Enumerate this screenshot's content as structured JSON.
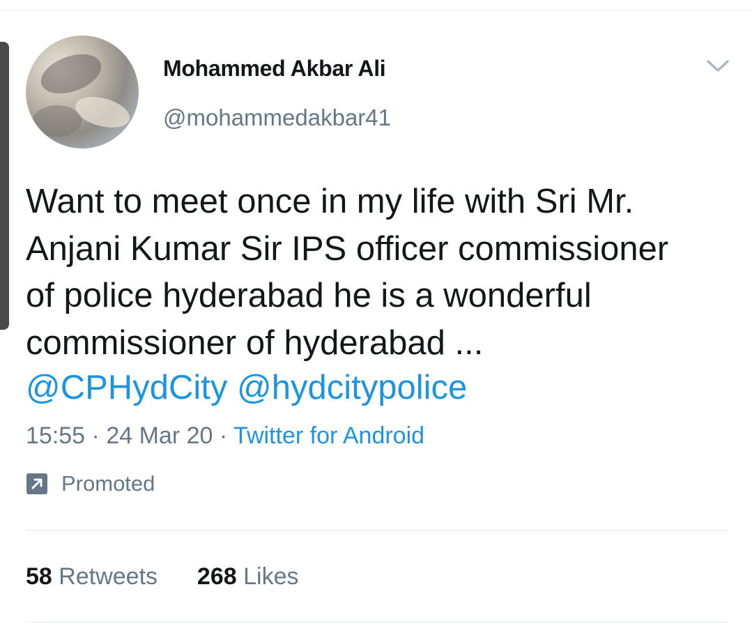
{
  "author": {
    "display_name": "Mohammed Akbar Ali",
    "handle": "@mohammedakbar41"
  },
  "tweet": {
    "text": "Want to meet once in my life with Sri Mr.\nAnjani Kumar Sir IPS officer commissioner\nof police hyderabad he is a wonderful\ncommissioner of hyderabad ...",
    "mentions": [
      "@CPHydCity",
      "@hydcitypolice"
    ],
    "time": "15:55",
    "separator": "·",
    "date": "24 Mar 20",
    "source": "Twitter for Android",
    "promoted_label": "Promoted"
  },
  "stats": {
    "retweets_count": "58",
    "retweets_label": "Retweets",
    "likes_count": "268",
    "likes_label": "Likes"
  },
  "icons": {
    "menu": "chevron-down-icon",
    "promoted": "promoted-arrow-icon"
  },
  "colors": {
    "link": "#1b95e0",
    "secondary_text": "#657786",
    "primary_text": "#14171a",
    "divider": "#e1e8ed"
  }
}
